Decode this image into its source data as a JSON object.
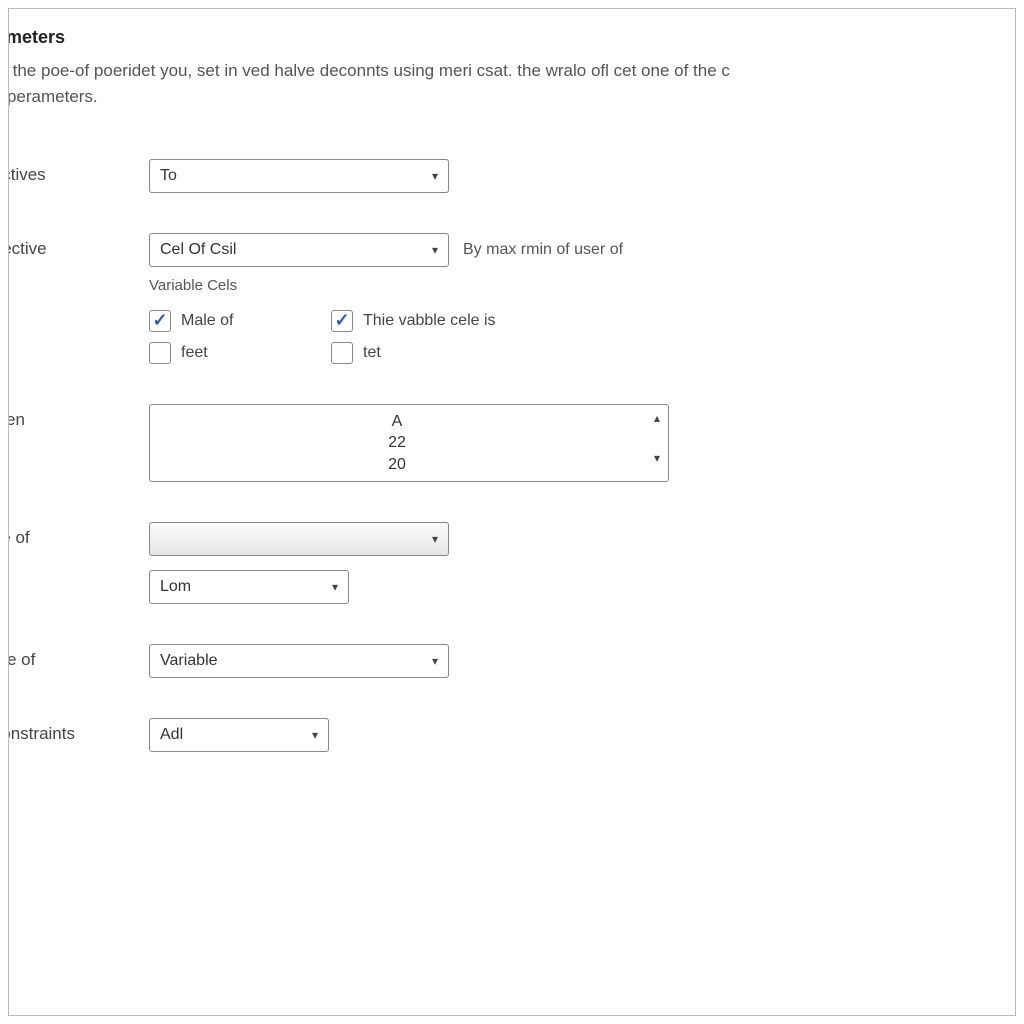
{
  "header": {
    "title": "rameters",
    "description": "de the poe-of poeridet you, set in ved halve deconnts using meri csat. the wralo ofl cet one of the c\nal perameters."
  },
  "rows": {
    "objectives": {
      "label": "jectives",
      "select_value": "To"
    },
    "objective": {
      "label": "bjective",
      "select_value": "Cel Of Csil",
      "hint": "By max rmin of user of",
      "sublabel": "Variable Cels",
      "checks": {
        "c1_label": "Male of",
        "c2_label": "Thie vabble cele is",
        "c3_label": "feet",
        "c4_label": "tet"
      }
    },
    "iglen": {
      "label": "iglen\nel",
      "line1": "A",
      "line2": "22",
      "line3": "20"
    },
    "ive": {
      "label": "ive of\nl",
      "select1_value": "",
      "select2_value": "Lom"
    },
    "oce": {
      "label": "oce of",
      "select_value": "Variable"
    },
    "constraints": {
      "label": "Constraints",
      "select_value": "Adl"
    }
  }
}
